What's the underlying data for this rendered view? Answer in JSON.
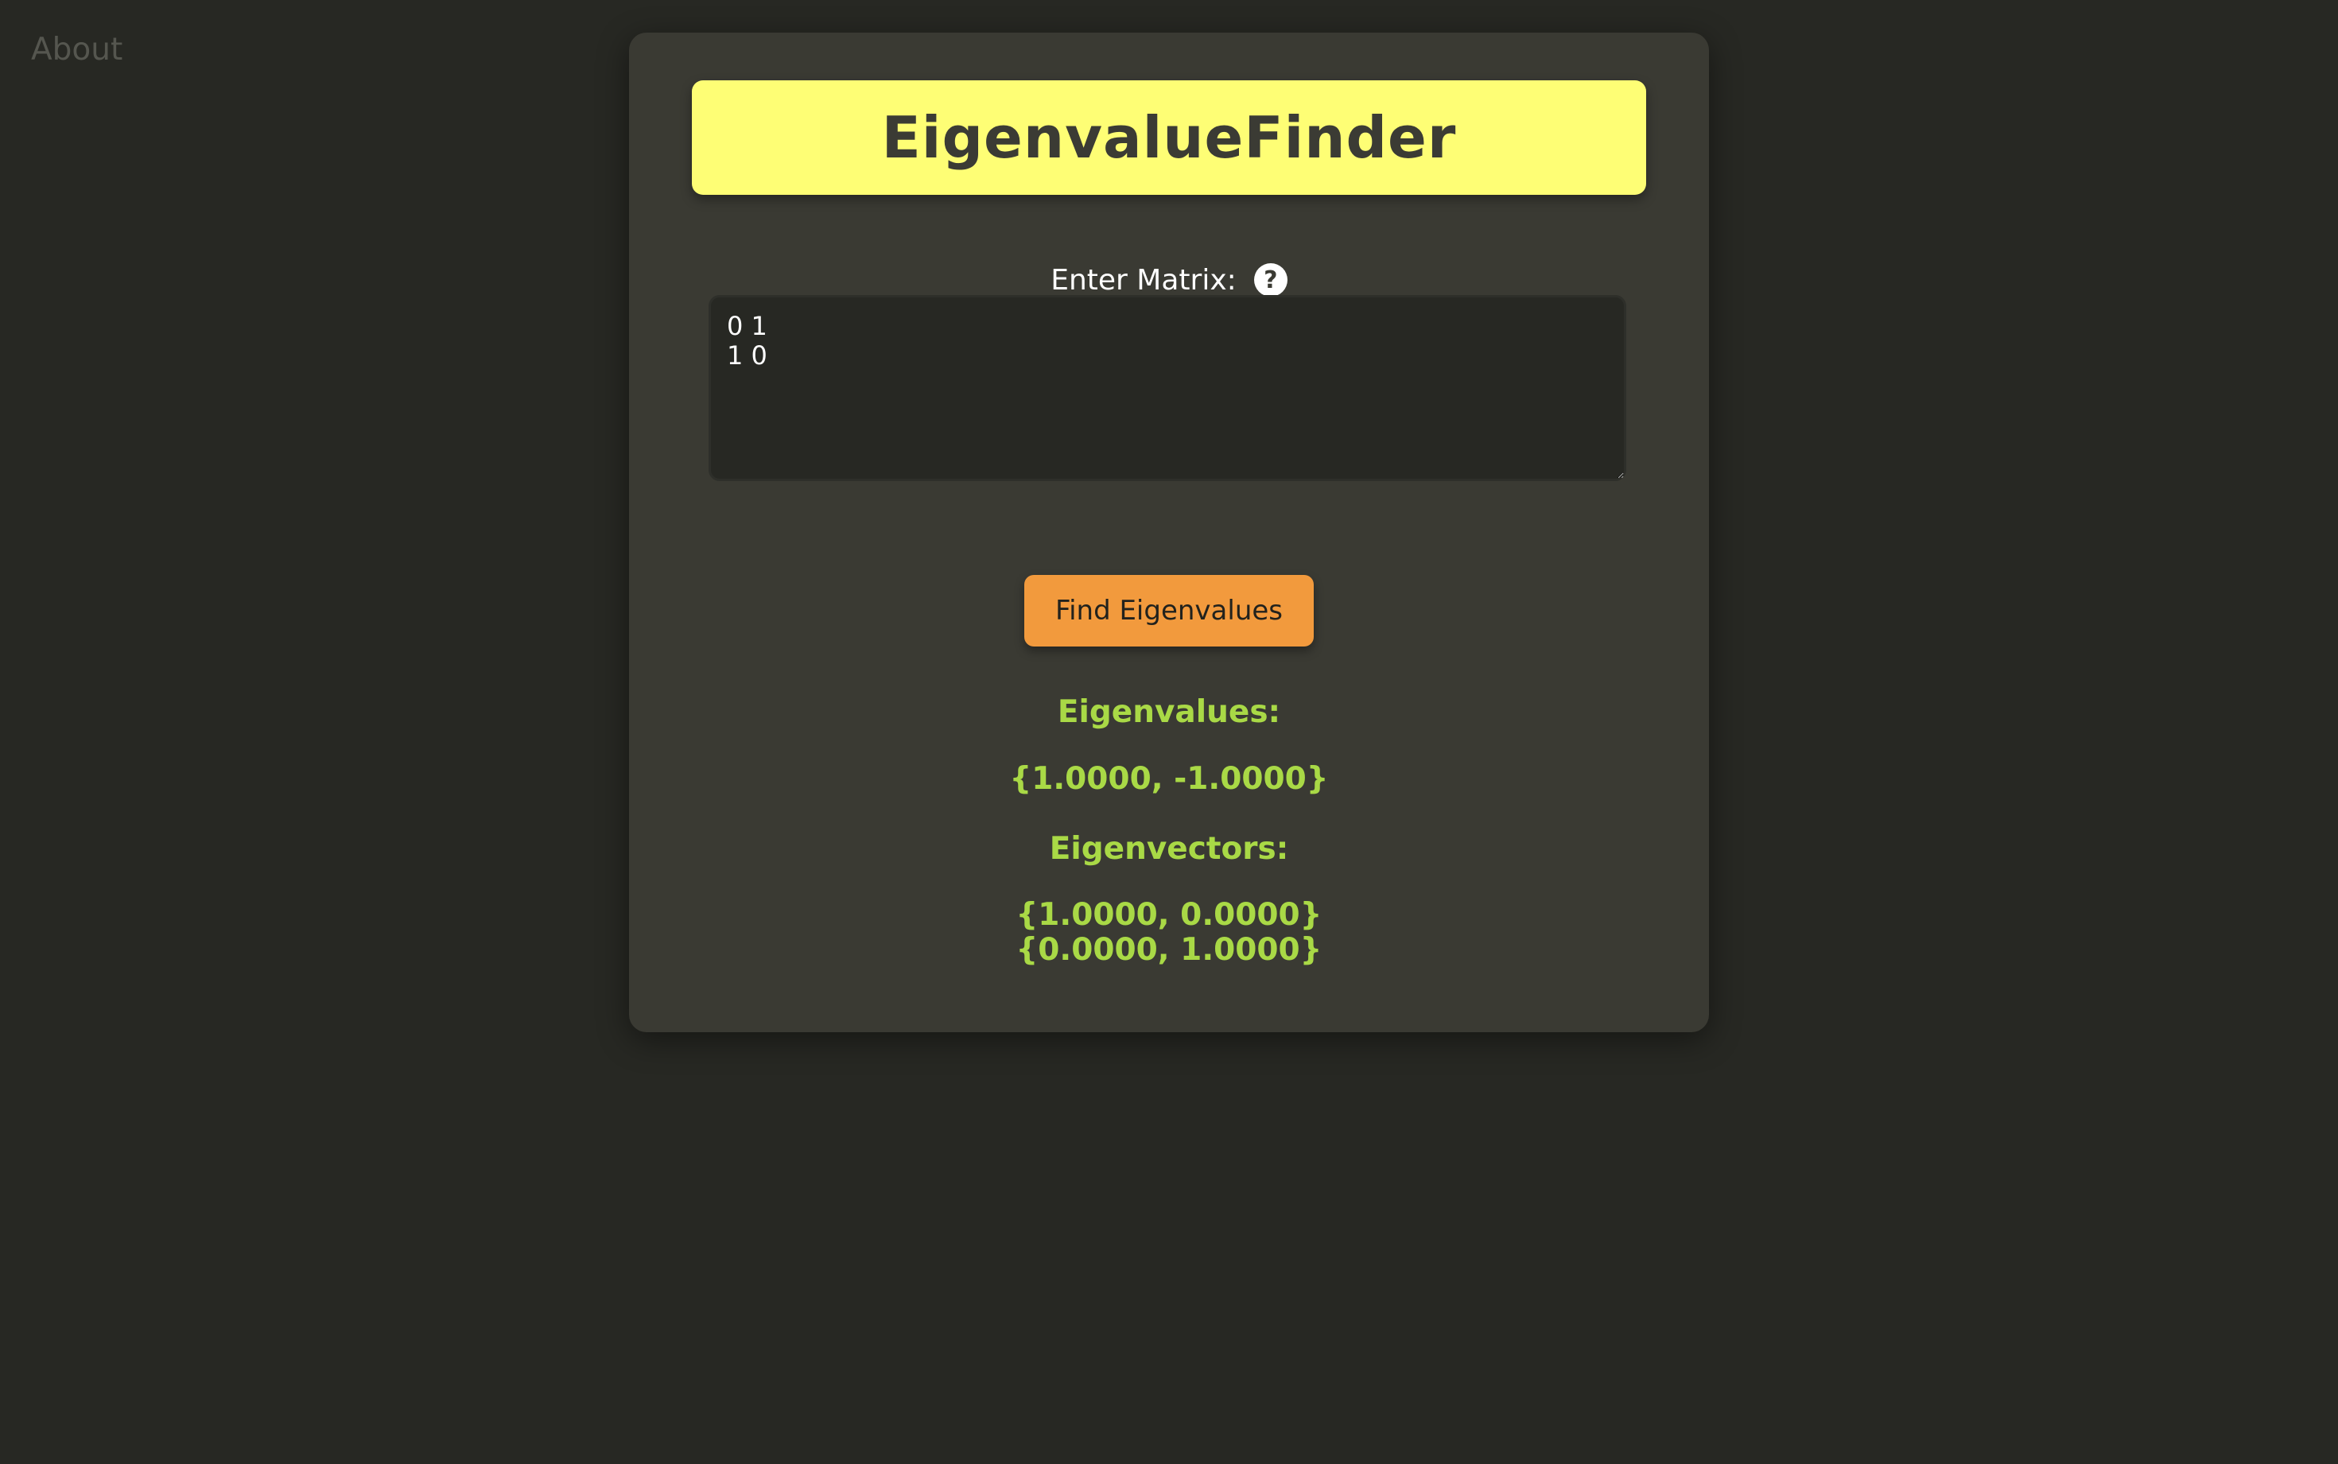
{
  "nav": {
    "about_label": "About"
  },
  "header": {
    "title": "EigenvalueFinder"
  },
  "matrix": {
    "label": "Enter Matrix:",
    "help_icon": "question-circle-icon",
    "value": "0 1\n1 0"
  },
  "actions": {
    "find_label": "Find Eigenvalues"
  },
  "results": {
    "eigenvalues_heading": "Eigenvalues:",
    "eigenvalues": "{1.0000, -1.0000}",
    "eigenvectors_heading": "Eigenvectors:",
    "eigenvectors": [
      "{1.0000, 0.0000}",
      "{0.0000, 1.0000}"
    ]
  },
  "colors": {
    "background": "#272823",
    "card": "#3a3a33",
    "title_banner": "#fefe75",
    "button": "#f29a3d",
    "result_text": "#a9d946"
  }
}
